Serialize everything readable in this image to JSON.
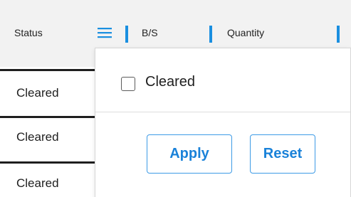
{
  "header": {
    "columns": [
      {
        "title": "Status"
      },
      {
        "title": "B/S"
      },
      {
        "title": "Quantity"
      }
    ],
    "menu_icon": "hamburger-menu-icon"
  },
  "rows": [
    {
      "status": "Cleared"
    },
    {
      "status": "Cleared"
    },
    {
      "status": "Cleared"
    }
  ],
  "filter_popup": {
    "checkbox_label": "Cleared",
    "checkbox_checked": false,
    "apply_label": "Apply",
    "reset_label": "Reset"
  },
  "colors": {
    "accent": "#1a8fe0",
    "button_text": "#1a82d9",
    "header_bg": "#f2f2f2"
  }
}
